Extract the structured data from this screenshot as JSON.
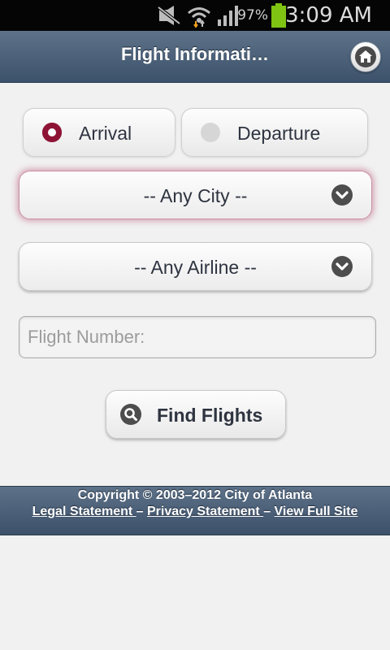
{
  "status_bar": {
    "battery_percent": "97%",
    "time": "3:09 AM",
    "icons": [
      "mute-icon",
      "wifi-icon",
      "signal-icon",
      "battery-icon"
    ]
  },
  "header": {
    "title": "Flight Informati…",
    "home_icon": "home-icon"
  },
  "flight_type": {
    "options": [
      {
        "label": "Arrival",
        "selected": true
      },
      {
        "label": "Departure",
        "selected": false
      }
    ]
  },
  "city_select": {
    "value": "-- Any City --"
  },
  "airline_select": {
    "value": "-- Any Airline --"
  },
  "flight_number": {
    "placeholder": "Flight Number:",
    "value": ""
  },
  "find_button": {
    "label": "Find Flights"
  },
  "footer": {
    "copyright": "Copyright © 2003–2012 City of Atlanta",
    "links": [
      "Legal Statement ",
      "Privacy Statement ",
      "View Full Site"
    ],
    "separator": "–"
  },
  "colors": {
    "header": "#4a5f78",
    "accent": "#8e1436",
    "background": "#f1f1f1"
  }
}
